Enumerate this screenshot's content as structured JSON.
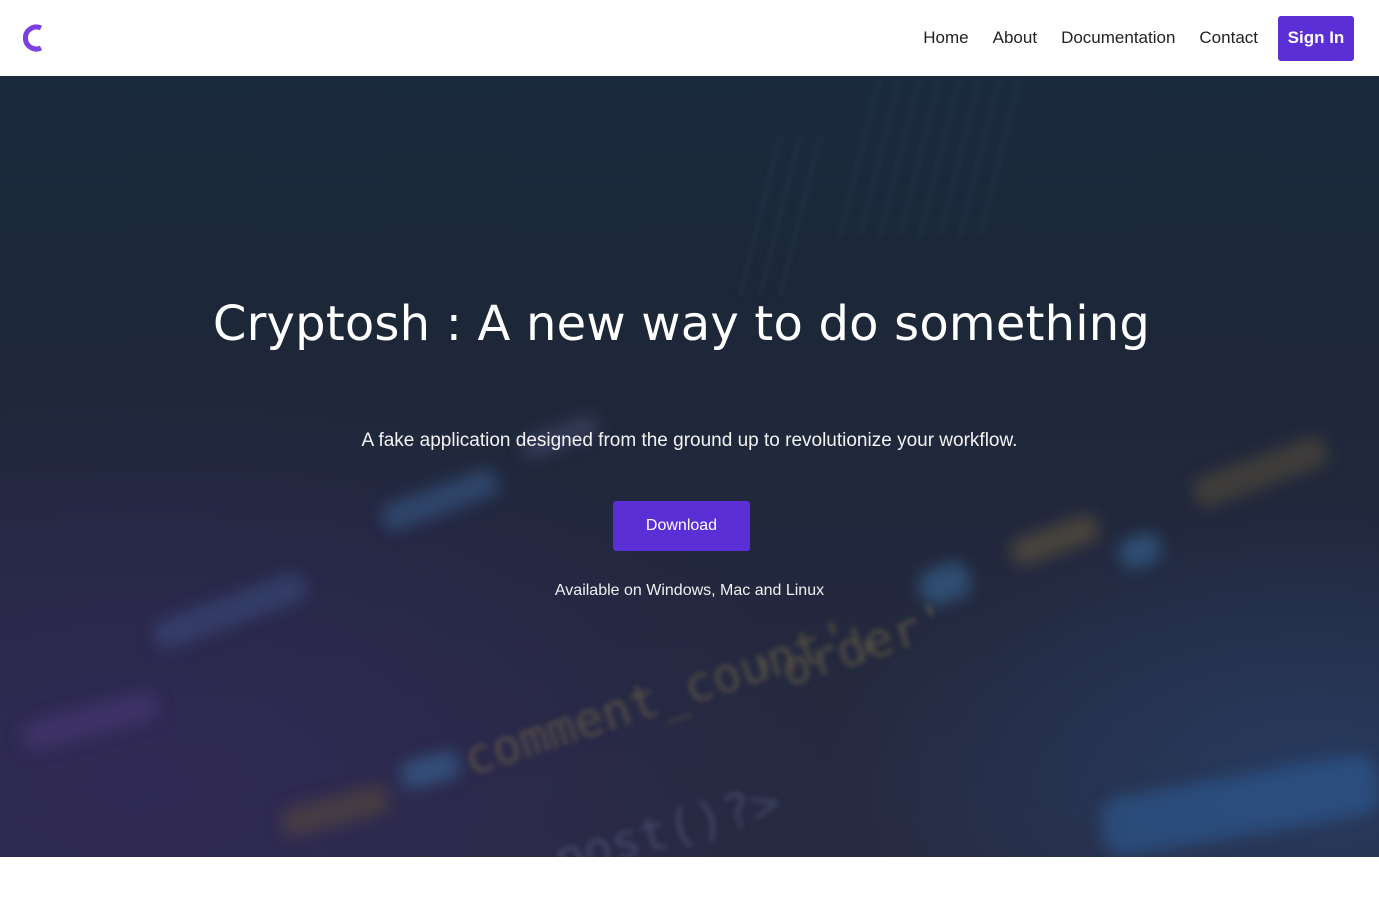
{
  "header": {
    "logo_icon": "c-logo-icon",
    "brand_color": "#7b3fe4",
    "nav": [
      {
        "label": "Home"
      },
      {
        "label": "About"
      },
      {
        "label": "Documentation"
      },
      {
        "label": "Contact"
      }
    ],
    "signin_label": "Sign In",
    "accent_color": "#5a2fd6"
  },
  "hero": {
    "title": "Cryptosh : A new way to do something",
    "subtitle": "A fake application designed from the ground up to revolutionize your workflow.",
    "download_label": "Download",
    "availability": "Available on Windows, Mac and Linux"
  }
}
